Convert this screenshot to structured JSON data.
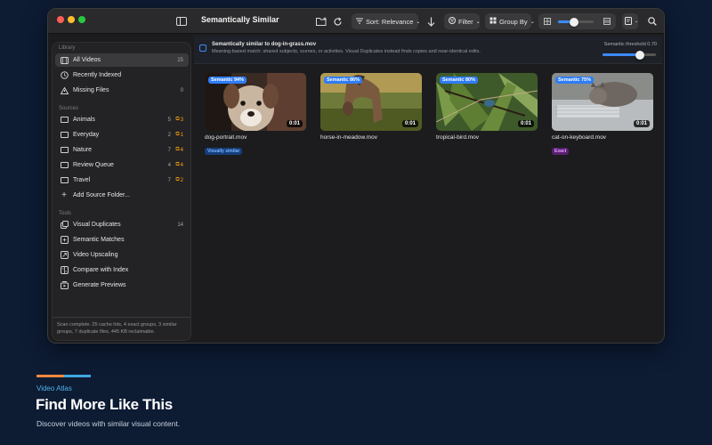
{
  "window": {
    "title": "Semantically Similar",
    "toolbar": {
      "sort_label": "Sort: Relevance",
      "filter_label": "Filter",
      "group_label": "Group By",
      "zoom_level": 0.45
    }
  },
  "sidebar": {
    "library_header": "Library",
    "library": [
      {
        "label": "All Videos",
        "count": "25",
        "icon": "film-icon"
      },
      {
        "label": "Recently Indexed",
        "count": "",
        "icon": "clock-icon"
      },
      {
        "label": "Missing Files",
        "count": "0",
        "icon": "warning-icon"
      }
    ],
    "sources_header": "Sources",
    "sources": [
      {
        "label": "Animals",
        "count": "5",
        "dups": "3"
      },
      {
        "label": "Everyday",
        "count": "2",
        "dups": "1"
      },
      {
        "label": "Nature",
        "count": "7",
        "dups": "4"
      },
      {
        "label": "Review Queue",
        "count": "4",
        "dups": "4"
      },
      {
        "label": "Travel",
        "count": "7",
        "dups": "2"
      }
    ],
    "add_source": "Add Source Folder...",
    "tools_header": "Tools",
    "tools": [
      {
        "label": "Visual Duplicates",
        "count": "14",
        "icon": "duplicate-icon"
      },
      {
        "label": "Semantic Matches",
        "count": "",
        "icon": "sparkle-icon"
      },
      {
        "label": "Video Upscaling",
        "count": "",
        "icon": "upscale-icon"
      },
      {
        "label": "Compare with Index",
        "count": "",
        "icon": "compare-icon"
      },
      {
        "label": "Generate Previews",
        "count": "",
        "icon": "preview-icon"
      }
    ],
    "status_text": "Scan complete. 25 cache hits, 4 exact groups, 3 similar groups, 7 duplicate files, 445 KB reclaimable."
  },
  "banner": {
    "title": "Semantically similar to dog-in-grass.mov",
    "subtitle": "Meaning-based match: shared subjects, scenes, or activities. Visual Duplicates instead finds copies and near-identical edits.",
    "threshold_label": "Semantic threshold 0.70",
    "threshold_value": 0.7
  },
  "results": [
    {
      "name": "dog-portrait.mov",
      "score": "Semantic 94%",
      "duration": "0:01",
      "tag": "Visually similar",
      "tag_type": "visual"
    },
    {
      "name": "horse-in-meadow.mov",
      "score": "Semantic 86%",
      "duration": "0:01",
      "tag": "",
      "tag_type": ""
    },
    {
      "name": "tropical-bird.mov",
      "score": "Semantic 80%",
      "duration": "0:01",
      "tag": "",
      "tag_type": ""
    },
    {
      "name": "cat-on-keyboard.mov",
      "score": "Semantic 75%",
      "duration": "0:01",
      "tag": "Exact",
      "tag_type": "exact"
    }
  ],
  "marketing": {
    "brand": "Video Atlas",
    "headline": "Find More Like This",
    "subline": "Discover videos with similar visual content."
  },
  "colors": {
    "background": "#0d1b33",
    "accent": "#3d8bff",
    "duplicate_badge": "#ff9f0a",
    "brand_orange": "#f08a3c",
    "brand_blue": "#3fa7e0"
  }
}
